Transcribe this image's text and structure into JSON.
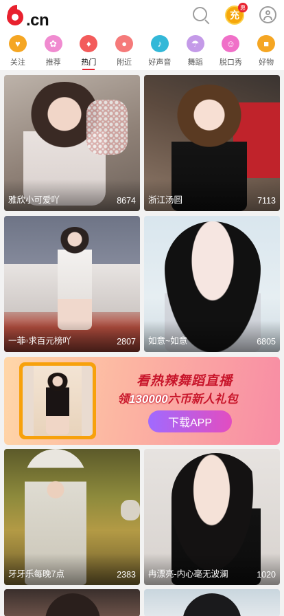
{
  "header": {
    "logo_text": ".cn",
    "recharge_label": "充",
    "recharge_badge": "惠"
  },
  "nav": {
    "items": [
      {
        "label": "关注",
        "color": "#f5a623",
        "glyph": "♥"
      },
      {
        "label": "推荐",
        "color": "#f08bd0",
        "glyph": "✿"
      },
      {
        "label": "热门",
        "color": "#f35b5b",
        "glyph": "♦"
      },
      {
        "label": "附近",
        "color": "#f57a7a",
        "glyph": "●"
      },
      {
        "label": "好声音",
        "color": "#33b8d8",
        "glyph": "♪"
      },
      {
        "label": "舞蹈",
        "color": "#c49ae8",
        "glyph": "☂"
      },
      {
        "label": "脱口秀",
        "color": "#f070c8",
        "glyph": "☺"
      },
      {
        "label": "好物",
        "color": "#f5a623",
        "glyph": "■"
      }
    ],
    "active_index": 2
  },
  "cards": [
    {
      "name": "雅欣小可爱吖",
      "count": "8674"
    },
    {
      "name": "浙江汤圆",
      "count": "7113"
    },
    {
      "name": "一菲▫求百元榜吖",
      "count": "2807"
    },
    {
      "name": "如意~如意",
      "count": "6805"
    },
    {
      "name": "牙牙乐每晚7点",
      "count": "2383"
    },
    {
      "name": "冉漂亮-内心毫无波澜",
      "count": "1020"
    }
  ],
  "banner": {
    "line1": "看热辣舞蹈直播",
    "line2_prefix": "领",
    "line2_number": "130000",
    "line2_suffix": "六币新人礼包",
    "button_label": "下载APP"
  }
}
